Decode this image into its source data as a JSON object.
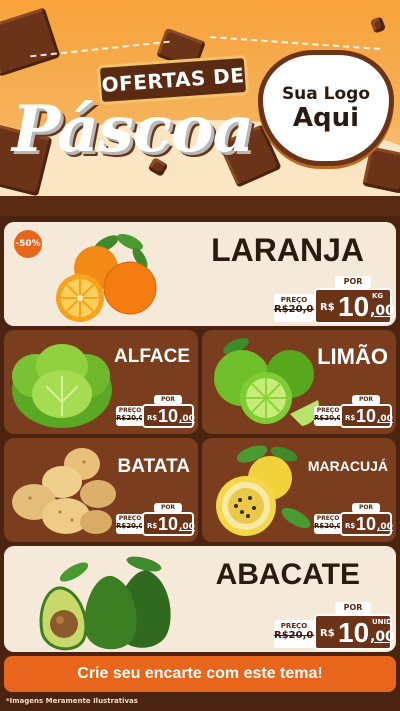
{
  "header": {
    "title_top": "OFERTAS DE",
    "title_script": "Páscoa",
    "logo_line1": "Sua Logo",
    "logo_line2": "Aqui"
  },
  "colors": {
    "accent": "#e8661c",
    "chocolate": "#6b3418",
    "card_light": "#f5ead9",
    "card_dark": "#7a3d1d"
  },
  "products": [
    {
      "name": "LARANJA",
      "badge": "-50%",
      "old_label": "PREÇO",
      "old_price": "R$20,00",
      "por_label": "POR",
      "currency": "R$",
      "price_big": "10",
      "price_cents": ",00",
      "unit": "KG",
      "icon": "orange-icon"
    },
    {
      "name": "ALFACE",
      "old_label": "PREÇO",
      "old_price": "R$20,00",
      "por_label": "POR",
      "currency": "R$",
      "price_big": "10",
      "price_cents": ",00",
      "icon": "lettuce-icon"
    },
    {
      "name": "LIMÃO",
      "old_label": "PREÇO",
      "old_price": "R$20,00",
      "por_label": "POR",
      "currency": "R$",
      "price_big": "10",
      "price_cents": ",00",
      "icon": "lime-icon"
    },
    {
      "name": "BATATA",
      "old_label": "PREÇO",
      "old_price": "R$20,00",
      "por_label": "POR",
      "currency": "R$",
      "price_big": "10",
      "price_cents": ",00",
      "icon": "potato-icon"
    },
    {
      "name": "MARACUJÁ",
      "old_label": "PREÇO",
      "old_price": "R$20,00",
      "por_label": "POR",
      "currency": "R$",
      "price_big": "10",
      "price_cents": ",00",
      "icon": "passion-fruit-icon"
    },
    {
      "name": "ABACATE",
      "old_label": "PREÇO",
      "old_price": "R$20,00",
      "por_label": "POR",
      "currency": "R$",
      "price_big": "10",
      "price_cents": ",00",
      "unit": "UNID",
      "icon": "avocado-icon"
    }
  ],
  "footer": {
    "cta": "Crie seu encarte com este tema!",
    "disclaimer": "*Imagens Meramente Ilustrativas"
  }
}
